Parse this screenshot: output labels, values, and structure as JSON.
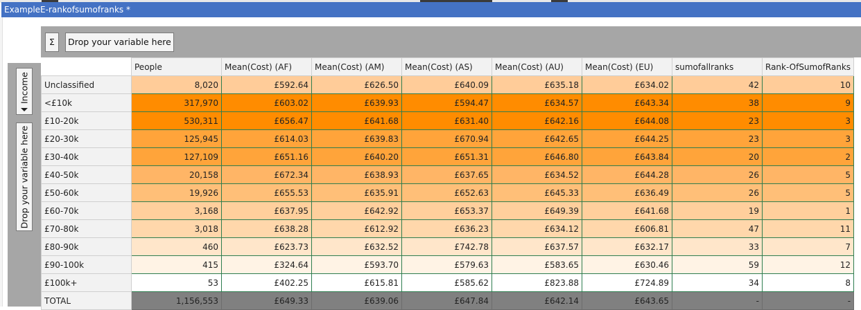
{
  "window": {
    "title": "ExampleE-rankofsumofranks *"
  },
  "toolbar": {
    "sigma_label": "Σ",
    "drop_variable_label": "Drop your variable here"
  },
  "row_field": {
    "label": "Income",
    "drop_variable_label": "Drop your variable here"
  },
  "table": {
    "columns": [
      "People",
      "Mean(Cost) (AF)",
      "Mean(Cost) (AM)",
      "Mean(Cost) (AS)",
      "Mean(Cost) (AU)",
      "Mean(Cost) (EU)",
      "sumofallranks",
      "Rank-OfSumofRanks"
    ],
    "heat_colors": {
      "Unclassified": "#ffcc99",
      "<£10k": "#ff8c00",
      "£10-20k": "#ff8c00",
      "£20-30k": "#ffa43a",
      "£30-40k": "#ffa43a",
      "£40-50k": "#ffb566",
      "£50-60k": "#ffbf78",
      "£60-70k": "#ffcf9c",
      "£70-80k": "#ffd7ab",
      "£80-90k": "#ffe6ca",
      "£90-100k": "#fff3e5",
      "£100k+": "#ffffff"
    },
    "rows": [
      {
        "label": "Unclassified",
        "values": [
          "8,020",
          "£592.64",
          "£626.50",
          "£640.09",
          "£635.18",
          "£634.02",
          "42",
          "10"
        ]
      },
      {
        "label": "<£10k",
        "values": [
          "317,970",
          "£603.02",
          "£639.93",
          "£594.47",
          "£634.57",
          "£643.34",
          "38",
          "9"
        ]
      },
      {
        "label": "£10-20k",
        "values": [
          "530,311",
          "£656.47",
          "£641.68",
          "£631.40",
          "£642.16",
          "£644.08",
          "23",
          "3"
        ]
      },
      {
        "label": "£20-30k",
        "values": [
          "125,945",
          "£614.03",
          "£639.83",
          "£670.94",
          "£642.65",
          "£644.25",
          "23",
          "3"
        ]
      },
      {
        "label": "£30-40k",
        "values": [
          "127,109",
          "£651.16",
          "£640.20",
          "£651.31",
          "£646.80",
          "£643.84",
          "20",
          "2"
        ]
      },
      {
        "label": "£40-50k",
        "values": [
          "20,158",
          "£672.34",
          "£638.93",
          "£637.65",
          "£634.52",
          "£644.28",
          "26",
          "5"
        ]
      },
      {
        "label": "£50-60k",
        "values": [
          "19,926",
          "£655.53",
          "£635.91",
          "£652.63",
          "£645.33",
          "£636.49",
          "26",
          "5"
        ]
      },
      {
        "label": "£60-70k",
        "values": [
          "3,168",
          "£637.95",
          "£642.92",
          "£653.37",
          "£649.39",
          "£641.68",
          "19",
          "1"
        ]
      },
      {
        "label": "£70-80k",
        "values": [
          "3,018",
          "£638.28",
          "£612.92",
          "£636.23",
          "£634.12",
          "£606.81",
          "47",
          "11"
        ]
      },
      {
        "label": "£80-90k",
        "values": [
          "460",
          "£623.73",
          "£632.52",
          "£742.78",
          "£637.57",
          "£632.17",
          "33",
          "7"
        ]
      },
      {
        "label": "£90-100k",
        "values": [
          "415",
          "£324.64",
          "£593.70",
          "£579.63",
          "£583.65",
          "£630.46",
          "59",
          "12"
        ]
      },
      {
        "label": "£100k+",
        "values": [
          "53",
          "£402.25",
          "£615.81",
          "£585.62",
          "£823.88",
          "£724.89",
          "34",
          "8"
        ]
      }
    ],
    "total": {
      "label": "TOTAL",
      "values": [
        "1,156,553",
        "£649.33",
        "£639.06",
        "£647.84",
        "£642.14",
        "£643.65",
        "-",
        "-"
      ]
    }
  }
}
